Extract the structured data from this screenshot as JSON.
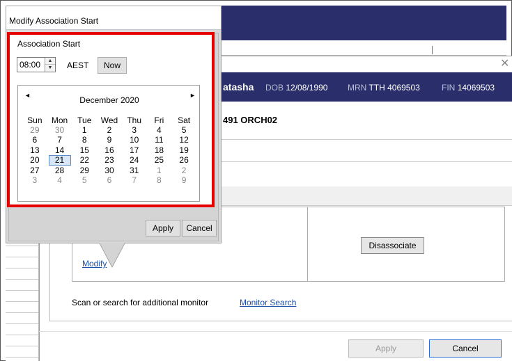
{
  "popup": {
    "title": "Modify Association Start",
    "section_label": "Association Start",
    "time_value": "08:00",
    "timezone": "AEST",
    "now_label": "Now",
    "apply_label": "Apply",
    "cancel_label": "Cancel"
  },
  "calendar": {
    "month_title": "December 2020",
    "prev_glyph": "◄",
    "next_glyph": "►",
    "weekdays": [
      "Sun",
      "Mon",
      "Tue",
      "Wed",
      "Thu",
      "Fri",
      "Sat"
    ],
    "selected_day": "21",
    "weeks": [
      [
        "29",
        "30",
        "1",
        "2",
        "3",
        "4",
        "5"
      ],
      [
        "6",
        "7",
        "8",
        "9",
        "10",
        "11",
        "12"
      ],
      [
        "13",
        "14",
        "15",
        "16",
        "17",
        "18",
        "19"
      ],
      [
        "20",
        "21",
        "22",
        "23",
        "24",
        "25",
        "26"
      ],
      [
        "27",
        "28",
        "29",
        "30",
        "31",
        "1",
        "2"
      ],
      [
        "3",
        "4",
        "5",
        "6",
        "7",
        "8",
        "9"
      ]
    ]
  },
  "banner": {
    "name_partial": "atasha",
    "dob_label": "DOB",
    "dob_value": "12/08/1990",
    "mrn_label": "MRN",
    "mrn_value": "TTH 4069503",
    "fin_label": "FIN",
    "fin_value": "14069503"
  },
  "dialog": {
    "close_glyph": "✕",
    "location_partial": "491 ORCH02",
    "modify_link": "Modify",
    "disassociate_label": "Disassociate",
    "scan_text": "Scan or search for additional monitor",
    "monitor_search_link": "Monitor Search",
    "apply_label": "Apply",
    "cancel_label": "Cancel"
  },
  "colors": {
    "navy": "#2a2f6b",
    "highlight_red": "#e50000",
    "link_blue": "#1a4fa8"
  }
}
